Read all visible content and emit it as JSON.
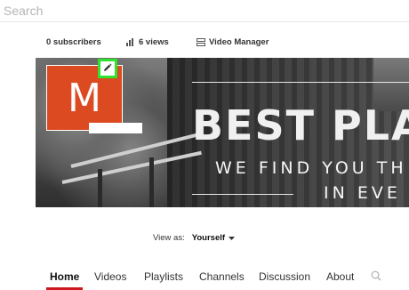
{
  "search": {
    "placeholder": "Search",
    "value": ""
  },
  "stats": {
    "subscribers": "0 subscribers",
    "views": "6 views",
    "video_manager": "Video Manager"
  },
  "banner": {
    "title": "BEST PLA",
    "subtitle_line1": "WE FIND YOU TH",
    "subtitle_line2": "IN EVE"
  },
  "avatar": {
    "letter": "M",
    "color": "#dc4a22"
  },
  "edit_icon": "pencil-icon",
  "highlight_color": "#2ee22e",
  "view_as": {
    "label": "View as:",
    "value": "Yourself"
  },
  "tabs": [
    {
      "label": "Home",
      "active": true
    },
    {
      "label": "Videos"
    },
    {
      "label": "Playlists"
    },
    {
      "label": "Channels"
    },
    {
      "label": "Discussion"
    },
    {
      "label": "About"
    }
  ],
  "accent_color": "#cc181e"
}
